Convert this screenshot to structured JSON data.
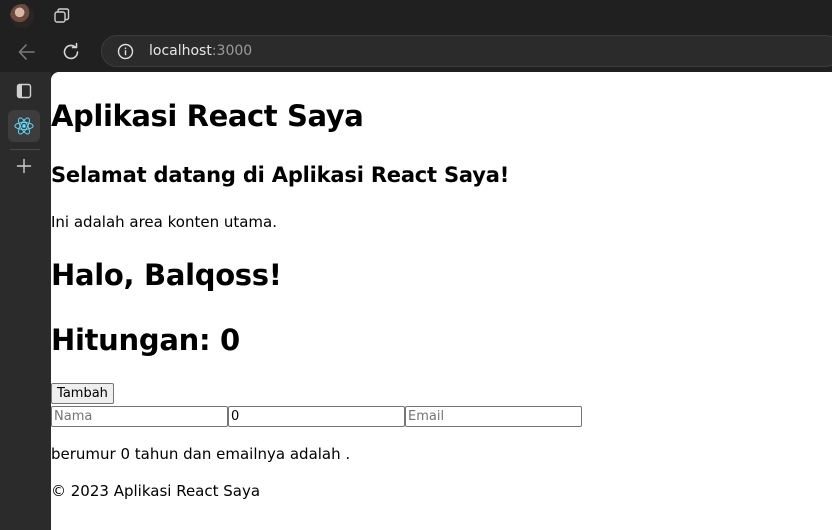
{
  "browser": {
    "url_host": "localhost",
    "url_port": ":3000"
  },
  "page": {
    "app_title": "Aplikasi React Saya",
    "welcome_heading": "Selamat datang di Aplikasi React Saya!",
    "main_text": "Ini adalah area konten utama.",
    "greeting": "Halo, Balqoss!",
    "counter_text": "Hitungan: 0",
    "add_button": "Tambah",
    "inputs": {
      "name_placeholder": "Nama",
      "name_value": "",
      "age_value": "0",
      "email_placeholder": "Email",
      "email_value": ""
    },
    "summary_text": "berumur 0 tahun dan emailnya adalah .",
    "footer_text": "© 2023 Aplikasi React Saya"
  },
  "icons": {
    "avatar": "profile-avatar",
    "workspaces": "workspaces-icon",
    "back": "back-arrow-icon",
    "reload": "reload-icon",
    "site_info": "info-icon",
    "vertical_tabs": "vertical-tabs-icon",
    "tab_favicon": "react-logo-icon",
    "new_tab": "plus-icon"
  },
  "colors": {
    "chrome_bg": "#202020",
    "sidebar_bg": "#2b2b2b",
    "react_cyan": "#61dafb",
    "page_bg": "#ffffff"
  }
}
